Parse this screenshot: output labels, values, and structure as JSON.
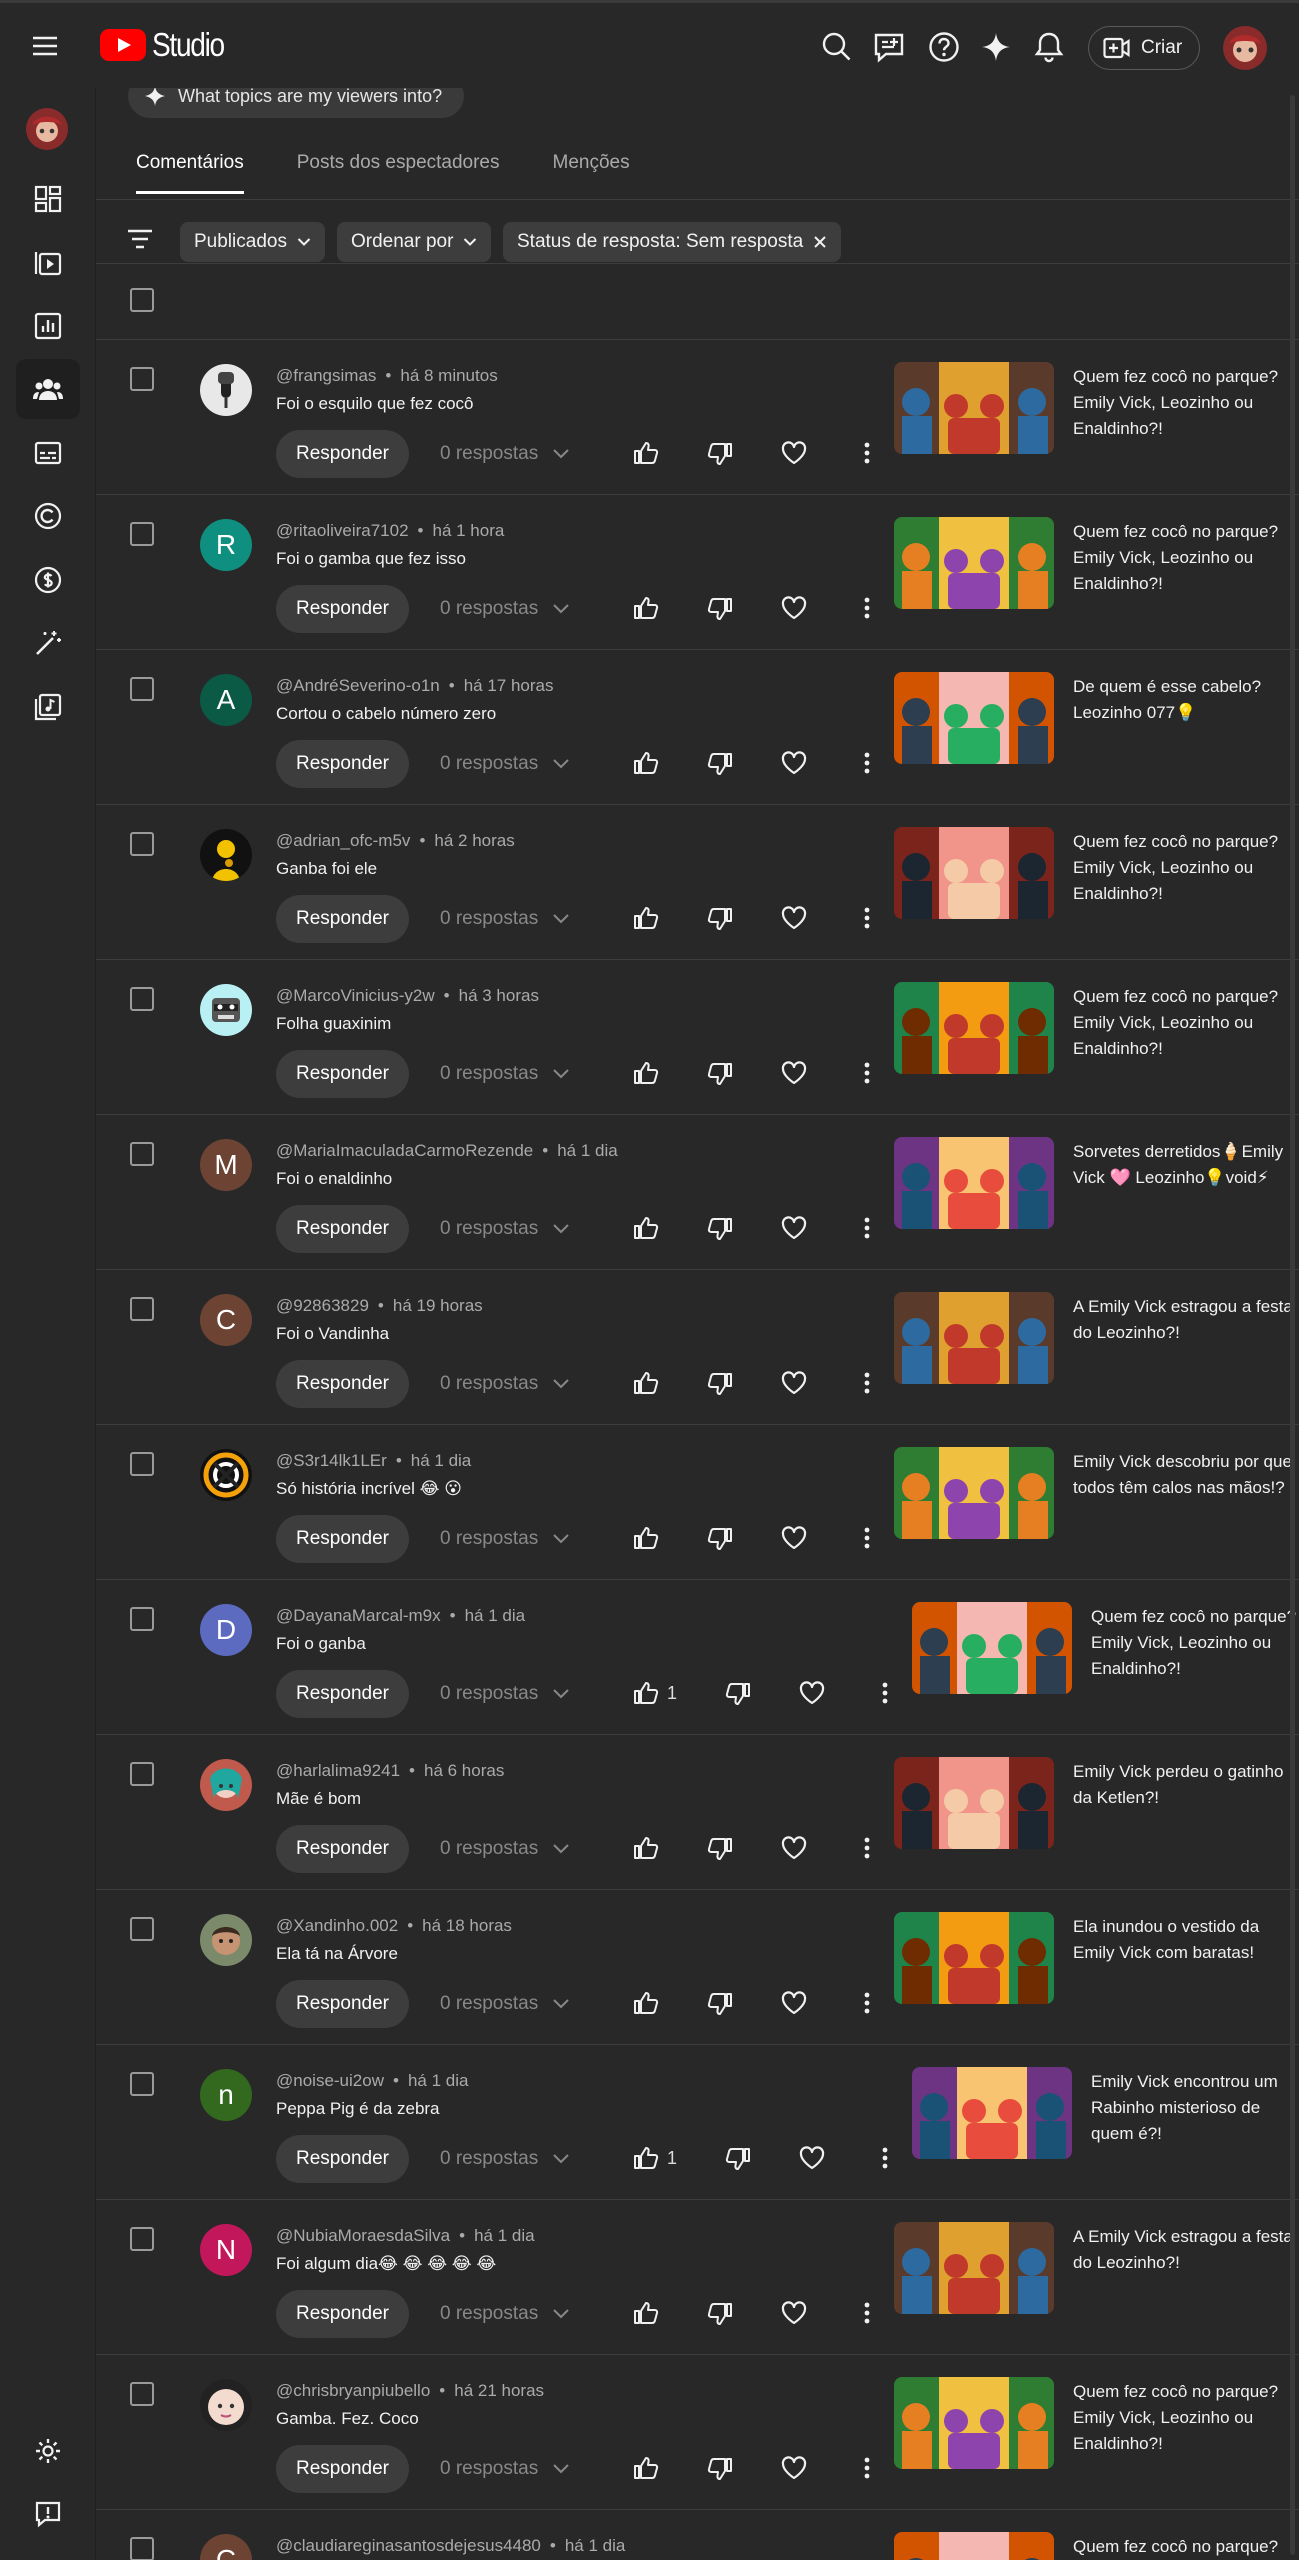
{
  "app": {
    "name": "Studio",
    "create_label": "Criar"
  },
  "topic_chip": "What topics are my viewers into?",
  "tabs": [
    {
      "label": "Comentários",
      "active": true
    },
    {
      "label": "Posts dos espectadores",
      "active": false
    },
    {
      "label": "Menções",
      "active": false
    }
  ],
  "filters": {
    "published": "Publicados",
    "sort": "Ordenar por",
    "status": "Status de resposta: Sem resposta"
  },
  "labels": {
    "reply": "Responder",
    "replies": "0 respostas"
  },
  "colors": {
    "background": "#282828",
    "brand_red": "#ff0000",
    "chip": "#3d3d3d"
  },
  "comments": [
    {
      "author": "@frangsimas",
      "time": "há 8 minutos",
      "text": "Foi o esquilo que fez cocô",
      "likes": "",
      "avatar": "img-mic",
      "video_title": "Quem fez cocô no parque? Emily Vick, Leozinho ou Enaldinho?!"
    },
    {
      "author": "@ritaoliveira7102",
      "time": "há 1 hora",
      "text": "Foi o gamba que fez isso",
      "likes": "",
      "avatar": "R",
      "avatar_color": "#0f8f7f",
      "video_title": "Quem fez cocô no parque? Emily Vick, Leozinho ou Enaldinho?!"
    },
    {
      "author": "@AndréSeverino-o1n",
      "time": "há 17 horas",
      "text": "Cortou o cabelo número zero",
      "likes": "",
      "avatar": "A",
      "avatar_color": "#0b5a46",
      "video_title": "De quem é esse cabelo? Leozinho 077💡"
    },
    {
      "author": "@adrian_ofc-m5v",
      "time": "há 2 horas",
      "text": "Ganba foi ele",
      "likes": "",
      "avatar": "img-yellow",
      "video_title": "Quem fez cocô no parque? Emily Vick, Leozinho ou Enaldinho?!"
    },
    {
      "author": "@MarcoVinicius-y2w",
      "time": "há 3 horas",
      "text": "Folha guaxinim",
      "likes": "",
      "avatar": "img-raccoon",
      "video_title": "Quem fez cocô no parque? Emily Vick, Leozinho ou Enaldinho?!"
    },
    {
      "author": "@MariaImaculadaCarmoRezende",
      "time": "há 1 dia",
      "text": "Foi o enaldinho",
      "likes": "",
      "avatar": "M",
      "avatar_color": "#6d4334",
      "video_title": "Sorvetes derretidos🍦Emily Vick 🩷 Leozinho💡void⚡"
    },
    {
      "author": "@92863829",
      "time": "há 19 horas",
      "text": "Foi o Vandinha",
      "likes": "",
      "avatar": "C",
      "avatar_color": "#6d4334",
      "video_title": "A Emily Vick estragou a festa do Leozinho?!"
    },
    {
      "author": "@S3r14lk1LEr",
      "time": "há 1 dia",
      "text": "Só história incrível 😂 😮",
      "likes": "",
      "avatar": "img-spiral",
      "video_title": "Emily Vick descobriu por que todos têm calos nas mãos!?"
    },
    {
      "author": "@DayanaMarcal-m9x",
      "time": "há 1 dia",
      "text": "Foi o ganba",
      "likes": "1",
      "avatar": "D",
      "avatar_color": "#5c6bc0",
      "shift": true,
      "video_title": "Quem fez cocô no parque? Emily Vick, Leozinho ou Enaldinho?!"
    },
    {
      "author": "@harlalima9241",
      "time": "há 6 horas",
      "text": "Mãe é bom",
      "likes": "",
      "avatar": "img-teal",
      "video_title": "Emily Vick perdeu o gatinho da Ketlen?!"
    },
    {
      "author": "@Xandinho.002",
      "time": "há 18 horas",
      "text": "Ela tá na Árvore",
      "likes": "",
      "avatar": "img-boy",
      "video_title": "Ela inundou o vestido da Emily Vick com baratas!"
    },
    {
      "author": "@noise-ui2ow",
      "time": "há 1 dia",
      "text": "Peppa Pig é da zebra",
      "likes": "1",
      "avatar": "n",
      "avatar_color": "#33691e",
      "shift": true,
      "video_title": "Emily Vick encontrou um Rabinho misterioso de quem é?!"
    },
    {
      "author": "@NubiaMoraesdaSilva",
      "time": "há 1 dia",
      "text": "Foi algum dia😂 😂 😂 😂 😂",
      "likes": "",
      "avatar": "N",
      "avatar_color": "#c2185b",
      "video_title": "A Emily Vick estragou a festa do Leozinho?!"
    },
    {
      "author": "@chrisbryanpiubello",
      "time": "há 21 horas",
      "text": "Gamba. Fez. Coco",
      "likes": "",
      "avatar": "img-baby",
      "video_title": "Quem fez cocô no parque? Emily Vick, Leozinho ou Enaldinho?!"
    },
    {
      "author": "@claudiareginasantosdejesus4480",
      "time": "há 1 dia",
      "text": "",
      "likes": "",
      "avatar": "C",
      "avatar_color": "#6d4334",
      "video_title": "Quem fez cocô no parque?"
    }
  ]
}
